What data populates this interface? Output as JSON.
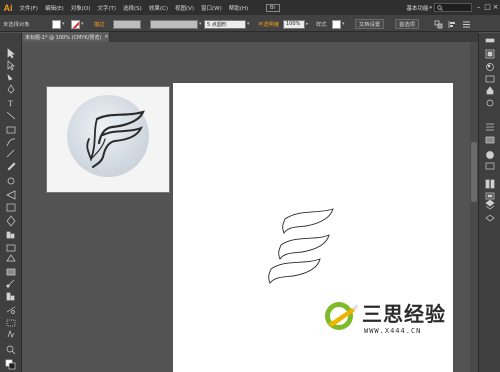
{
  "app": {
    "logo": "Ai",
    "bridge_label": "Br",
    "workspace_label": "基本功能",
    "search_placeholder": ""
  },
  "menu": [
    "文件(F)",
    "编辑(E)",
    "对象(O)",
    "文字(T)",
    "选择(S)",
    "效果(C)",
    "视图(V)",
    "窗口(W)",
    "帮助(H)"
  ],
  "window_controls": [
    "minimize-icon",
    "maximize-icon",
    "close-icon"
  ],
  "control_bar": {
    "selection_label": "未选择对象",
    "stroke_label": "描边",
    "stroke_value": "",
    "brush_value": "",
    "point_label": "5 点圆形",
    "opacity_link": "不透明度",
    "opacity_value": "100%",
    "style_label": "样式",
    "doc_setup_label": "文档设置",
    "preferences_label": "首选项"
  },
  "document_tab": {
    "title": "未标题-1* @ 100% (CMYK/预览)",
    "close": "×"
  },
  "watermark": {
    "title": "三思经验",
    "url": "WWW.X444.CN"
  },
  "colors": {
    "menubar_bg": "#2f2f2f",
    "panel_bg": "#424242",
    "workspace_bg": "#535353",
    "artboard_bg": "#ffffff",
    "accent_orange": "#f29a1c",
    "watermark_green": "#7dbb2a"
  }
}
